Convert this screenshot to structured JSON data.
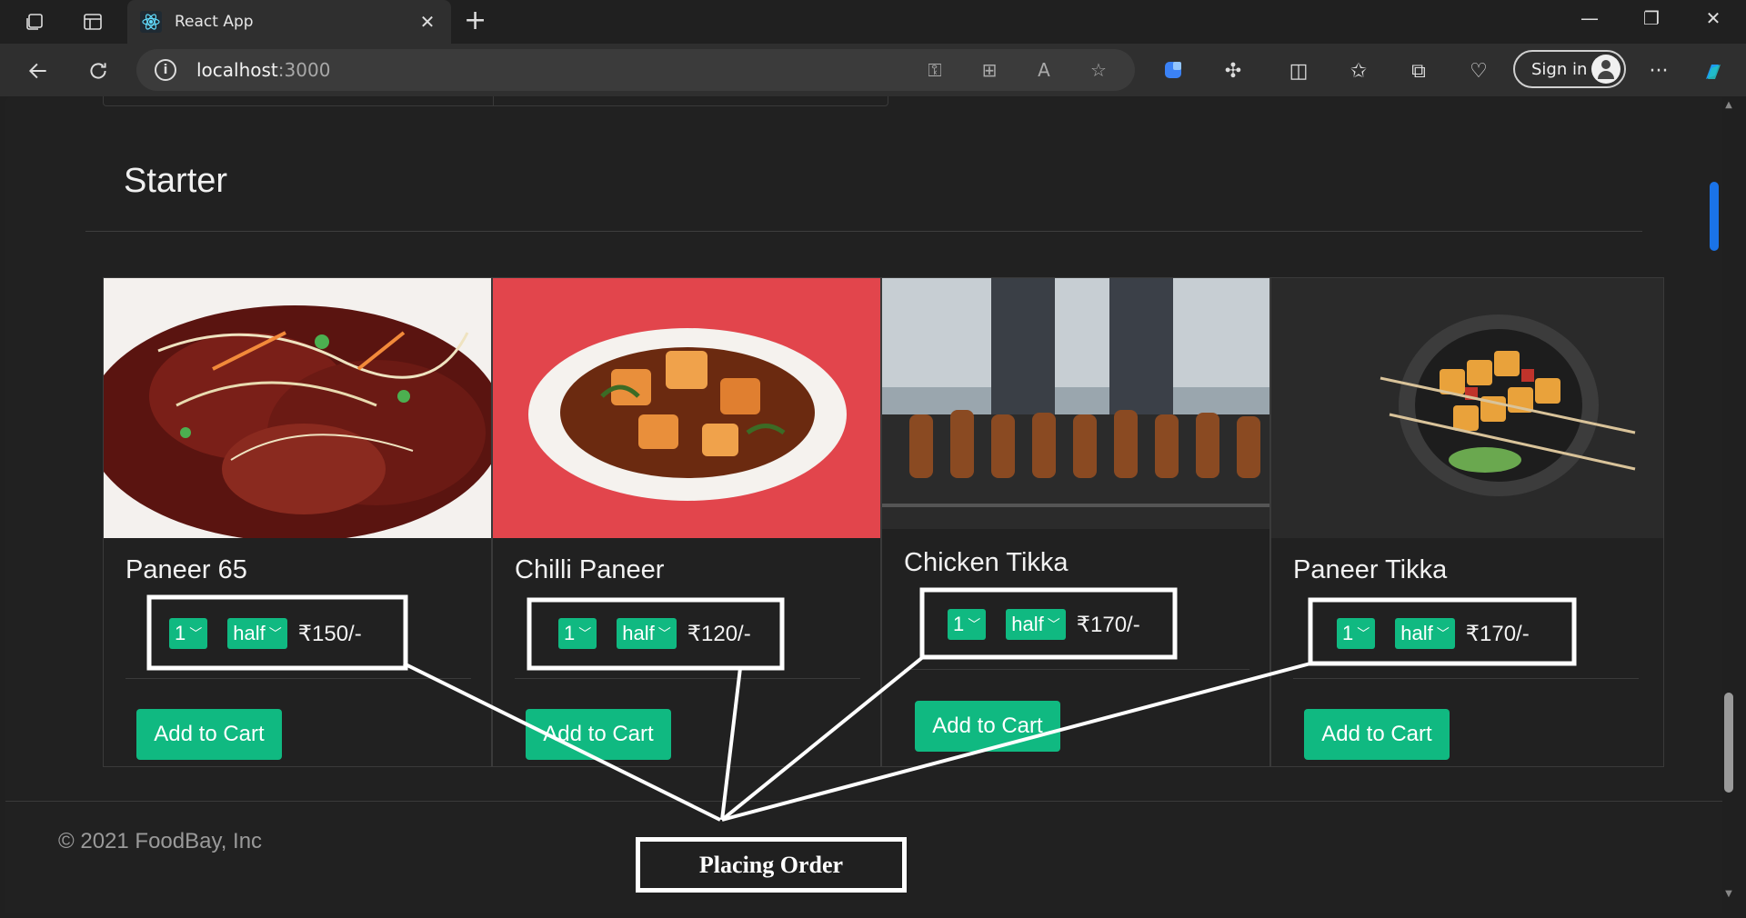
{
  "browser": {
    "tab_title": "React App",
    "url_host": "localhost",
    "url_port": ":3000",
    "sign_in": "Sign in"
  },
  "page": {
    "section_title": "Starter",
    "footer": "© 2021 FoodBay, Inc",
    "items": [
      {
        "name": "Paneer 65",
        "qty": "1",
        "size": "half",
        "price": "₹150/-",
        "button": "Add to Cart"
      },
      {
        "name": "Chilli Paneer",
        "qty": "1",
        "size": "half",
        "price": "₹120/-",
        "button": "Add to Cart"
      },
      {
        "name": "Chicken Tikka",
        "qty": "1",
        "size": "half",
        "price": "₹170/-",
        "button": "Add to Cart"
      },
      {
        "name": "Paneer Tikka",
        "qty": "1",
        "size": "half",
        "price": "₹170/-",
        "button": "Add to Cart"
      }
    ]
  },
  "annotation": {
    "label": "Placing Order"
  }
}
